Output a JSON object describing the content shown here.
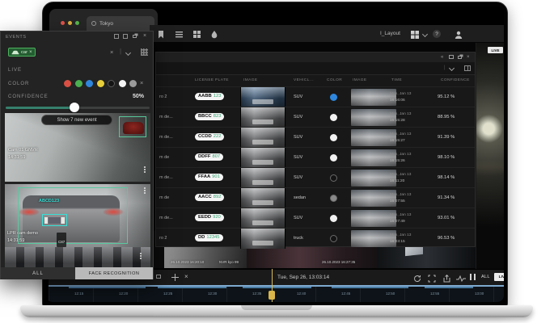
{
  "icons": {
    "close_glyph": "×",
    "help_glyph": "?",
    "divider_glyph": "|",
    "collapse_glyph": "«",
    "chip_close_glyph": "×"
  },
  "browser_window": {
    "tab_title": "Tokyo"
  },
  "events_panel": {
    "title": "EVENTS",
    "filter_chip_label": "car",
    "live_label": "LIVE",
    "color_label": "COLOR",
    "color_options": [
      "#d94f43",
      "#4caf50",
      "#2f87dd",
      "#e8cf3a",
      "#141414",
      "#f5f5f5",
      "#9a9a9a"
    ],
    "confidence_label": "CONFIDENCE",
    "confidence_value": "50%",
    "new_events_button_label": "Show 7 new event",
    "camera1_name": "Cam 01 GNVR",
    "camera1_time": "14:31:59",
    "camera2_name": "LPR cam demo",
    "camera2_time": "14:31:59",
    "camera2_plate": "ABCD123",
    "camera2_tag": "C87",
    "tab_all": "ALL",
    "tab_face": "FACE RECOGNITION"
  },
  "main_window": {
    "layout_selector_label": "I_Layout",
    "live_badge": "LIVE",
    "events_table": {
      "columns": {
        "license_plate": "LICENSE PLATE",
        "image1": "IMAGE",
        "vehicle": "VEHICL...",
        "color": "COLOR",
        "image2": "IMAGE",
        "time": "TIME",
        "confidence": "CONFIDENCE"
      },
      "rows": [
        {
          "camera": "ro 2",
          "plate_left": "AABB",
          "plate_right": "123",
          "vehicle": "SUV",
          "color_hex": "#2f87dd",
          "color_ring": false,
          "img_tint": "#4a6f96",
          "date": "Mon, Jan 13",
          "time": "16:16:06",
          "confidence": "95.12 %"
        },
        {
          "camera": "m de...",
          "plate_left": "BBCC",
          "plate_right": "823",
          "vehicle": "SUV",
          "color_hex": "#f2f2f2",
          "color_ring": false,
          "img_tint": "",
          "date": "Mon, Jan 13",
          "time": "16:15:28",
          "confidence": "88.95 %"
        },
        {
          "camera": "m de...",
          "plate_left": "CCDD",
          "plate_right": "222",
          "vehicle": "SUV",
          "color_hex": "#f2f2f2",
          "color_ring": false,
          "img_tint": "",
          "date": "Mon, Jan 13",
          "time": "16:15:27",
          "confidence": "91.39 %"
        },
        {
          "camera": "m de",
          "plate_left": "DDFF",
          "plate_right": "807",
          "vehicle": "SUV",
          "color_hex": "#f2f2f2",
          "color_ring": false,
          "img_tint": "",
          "date": "Mon, Jan 13",
          "time": "16:15:26",
          "confidence": "98.10 %"
        },
        {
          "camera": "m de...",
          "plate_left": "FFAA",
          "plate_right": "901",
          "vehicle": "SUV",
          "color_hex": "#141414",
          "color_ring": true,
          "img_tint": "",
          "date": "Mon, Jan 13",
          "time": "16:11:20",
          "confidence": "98.14 %"
        },
        {
          "camera": "m de",
          "plate_left": "AACC",
          "plate_right": "892",
          "vehicle": "sedan",
          "color_hex": "#8a8a8a",
          "color_ring": true,
          "img_tint": "",
          "date": "Mon, Jan 13",
          "time": "16:07:55",
          "confidence": "91.34 %"
        },
        {
          "camera": "m de...",
          "plate_left": "EEDD",
          "plate_right": "920",
          "vehicle": "SUV",
          "color_hex": "#f2f2f2",
          "color_ring": false,
          "img_tint": "",
          "date": "Mon, Jan 13",
          "time": "16:07:49",
          "confidence": "93.01 %"
        },
        {
          "camera": "ro 2",
          "plate_left": "DD",
          "plate_right": "12345",
          "vehicle": "truck",
          "color_hex": "#141414",
          "color_ring": true,
          "img_tint": "",
          "date": "Mon, Jan 13",
          "time": "16:03:15",
          "confidence": "96.53 %"
        }
      ]
    },
    "video_strip": {
      "timestamp_left": "26.10.2023 16:20:10",
      "label_mid": "NVR kyo 99",
      "timestamp_right": "26.10.2023 16:27:35"
    },
    "timeline": {
      "current_time": "Tue, Sep 26, 13:03:14",
      "all_button": "ALL",
      "live_button": "LIVE",
      "ticks": [
        "12:15",
        "12:20",
        "12:25",
        "12:30",
        "12:35",
        "12:40",
        "12:45",
        "12:50",
        "12:55",
        "13:00"
      ]
    }
  }
}
